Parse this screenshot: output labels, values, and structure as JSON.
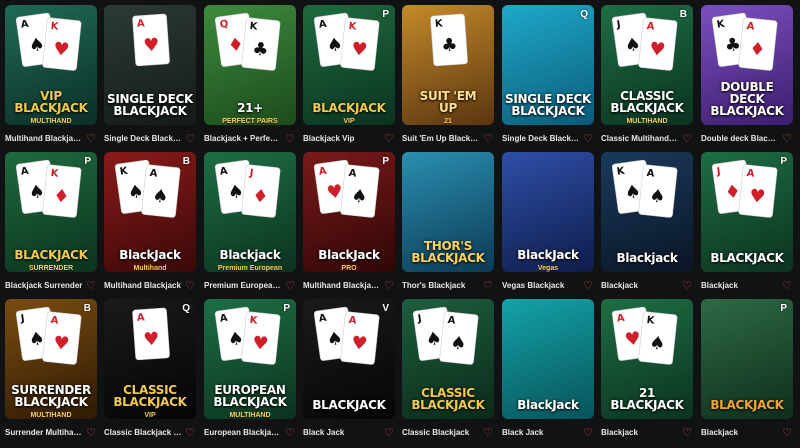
{
  "colors": {
    "background": "#111214",
    "caption": "#e8e8e8",
    "heart": "#e24a4a"
  },
  "favorite_icon": "heart-outline-icon",
  "games": [
    {
      "caption": "Multihand Blackjac…",
      "badge": "",
      "art_title": "VIP\nBLACKJACK",
      "art_sub": "MULTIHAND",
      "bg1": "#1f6a55",
      "bg2": "#0b2f27",
      "art_color": "#f2c94c",
      "cards": [
        "A♠",
        "K♥"
      ]
    },
    {
      "caption": "Single Deck Blackj…",
      "badge": "",
      "art_title": "SINGLE DECK\nBLACKJACK",
      "art_sub": "",
      "bg1": "#2c3a35",
      "bg2": "#141b19",
      "art_color": "#ffffff",
      "cards": [
        "A♥"
      ]
    },
    {
      "caption": "Blackjack + Perfec…",
      "badge": "",
      "art_title": "21+",
      "art_sub": "PERFECT PAIRS",
      "bg1": "#3d8b3d",
      "bg2": "#1c4a1c",
      "art_color": "#ffffff",
      "cards": [
        "Q♦",
        "K♣"
      ]
    },
    {
      "caption": "Blackjack Vip",
      "badge": "P",
      "art_title": "BLACKJACK",
      "art_sub": "VIP",
      "bg1": "#1e6b3e",
      "bg2": "#0b3320",
      "art_color": "#f2c94c",
      "cards": [
        "A♠",
        "K♥"
      ]
    },
    {
      "caption": "Suit 'Em Up Blackj…",
      "badge": "",
      "art_title": "SUIT 'EM\nUP",
      "art_sub": "21",
      "bg1": "#c48a2a",
      "bg2": "#5a3510",
      "art_color": "#ffe08a",
      "cards": [
        "K♣"
      ]
    },
    {
      "caption": "Single Deck Blackj…",
      "badge": "Q",
      "art_title": "SINGLE DECK\nBLACKJACK",
      "art_sub": "",
      "bg1": "#1fa9c9",
      "bg2": "#0b5b7a",
      "art_color": "#ffffff",
      "cards": []
    },
    {
      "caption": "Classic Multihand …",
      "badge": "B",
      "art_title": "CLASSIC\nBLACKJACK",
      "art_sub": "MULTIHAND",
      "bg1": "#1e6e44",
      "bg2": "#0b3320",
      "art_color": "#ffffff",
      "cards": [
        "J♠",
        "A♥"
      ]
    },
    {
      "caption": "Double deck Black…",
      "badge": "",
      "art_title": "DOUBLE DECK\nBLACKJACK",
      "art_sub": "",
      "bg1": "#7c4ec0",
      "bg2": "#3b1e6e",
      "art_color": "#ffffff",
      "cards": [
        "K♣",
        "A♦"
      ]
    },
    {
      "caption": "Blackjack Surrender",
      "badge": "P",
      "art_title": "BLACKJACK",
      "art_sub": "SURRENDER",
      "bg1": "#1f6a3e",
      "bg2": "#0b331e",
      "art_color": "#f2c94c",
      "cards": [
        "A♠",
        "K♦"
      ]
    },
    {
      "caption": "Multihand Blackjack",
      "badge": "B",
      "art_title": "BlackJack",
      "art_sub": "Multihand",
      "bg1": "#8a1a1a",
      "bg2": "#3a0808",
      "art_color": "#ffffff",
      "cards": [
        "K♠",
        "A♠"
      ]
    },
    {
      "caption": "Premium European…",
      "badge": "",
      "art_title": "Blackjack",
      "art_sub": "Premium European",
      "bg1": "#1e6e44",
      "bg2": "#0b3320",
      "art_color": "#ffffff",
      "cards": [
        "A♠",
        "J♦"
      ]
    },
    {
      "caption": "Multihand Blackjac…",
      "badge": "P",
      "art_title": "BlackJack",
      "art_sub": "PRO",
      "bg1": "#7a1a1a",
      "bg2": "#300606",
      "art_color": "#ffffff",
      "cards": [
        "A♥",
        "A♠"
      ]
    },
    {
      "caption": "Thor's Blackjack",
      "badge": "",
      "art_title": "THOR'S\nBLACKJACK",
      "art_sub": "",
      "bg1": "#2a8fb0",
      "bg2": "#0c3a55",
      "art_color": "#ffd35a",
      "cards": []
    },
    {
      "caption": "Vegas Blackjack",
      "badge": "",
      "art_title": "BlackJack",
      "art_sub": "Vegas",
      "bg1": "#2e4fa8",
      "bg2": "#0f1c4a",
      "art_color": "#ffffff",
      "cards": []
    },
    {
      "caption": "Blackjack",
      "badge": "",
      "art_title": "Blackjack",
      "art_sub": "",
      "bg1": "#1a3a5c",
      "bg2": "#0a1626",
      "art_color": "#ffffff",
      "cards": [
        "K♠",
        "A♠"
      ]
    },
    {
      "caption": "Blackjack",
      "badge": "P",
      "art_title": "BLACKJACK",
      "art_sub": "",
      "bg1": "#1e6e44",
      "bg2": "#0b3320",
      "art_color": "#ffffff",
      "cards": [
        "J♦",
        "A♥"
      ]
    },
    {
      "caption": "Surrender Multihan…",
      "badge": "B",
      "art_title": "SURRENDER\nBLACKJACK",
      "art_sub": "MULTIHAND",
      "bg1": "#7a4d10",
      "bg2": "#2e1a04",
      "art_color": "#ffffff",
      "cards": [
        "J♠",
        "A♥"
      ]
    },
    {
      "caption": "Classic Blackjack …",
      "badge": "Q",
      "art_title": "CLASSIC\nBLACKJACK",
      "art_sub": "VIP",
      "bg1": "#1a1a1a",
      "bg2": "#050505",
      "art_color": "#f2c94c",
      "cards": [
        "A♥"
      ]
    },
    {
      "caption": "European Blackjac…",
      "badge": "P",
      "art_title": "EUROPEAN\nBLACKJACK",
      "art_sub": "MULTIHAND",
      "bg1": "#1e6e44",
      "bg2": "#0b3320",
      "art_color": "#ffffff",
      "cards": [
        "A♠",
        "K♥"
      ]
    },
    {
      "caption": "Black Jack",
      "badge": "V",
      "art_title": "BLACKJACK",
      "art_sub": "",
      "bg1": "#1a1a1a",
      "bg2": "#060606",
      "art_color": "#ffffff",
      "cards": [
        "A♠",
        "A♥"
      ]
    },
    {
      "caption": "Classic Blackjack",
      "badge": "",
      "art_title": "CLASSIC\nBLACKJACK",
      "art_sub": "",
      "bg1": "#1e5e3e",
      "bg2": "#0a2a1a",
      "art_color": "#f2c94c",
      "cards": [
        "J♠",
        "A♠"
      ]
    },
    {
      "caption": "Black Jack",
      "badge": "",
      "art_title": "BlackJack",
      "art_sub": "",
      "bg1": "#13a3a8",
      "bg2": "#08535a",
      "art_color": "#ffffff",
      "cards": []
    },
    {
      "caption": "Blackjack",
      "badge": "",
      "art_title": "21\nBLACKJACK",
      "art_sub": "",
      "bg1": "#1e6e44",
      "bg2": "#0b3320",
      "art_color": "#ffffff",
      "cards": [
        "A♥",
        "K♠"
      ]
    },
    {
      "caption": "Blackjack",
      "badge": "P",
      "art_title": "BLACKJACK",
      "art_sub": "",
      "bg1": "#2e6a45",
      "bg2": "#0f2e1c",
      "art_color": "#f2a531",
      "cards": []
    }
  ]
}
